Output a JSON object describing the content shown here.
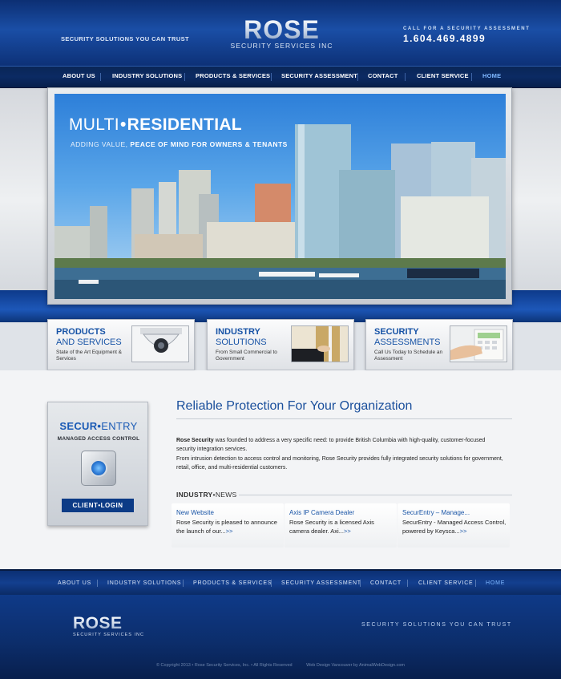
{
  "header": {
    "tagline": "SECURITY SOLUTIONS YOU CAN TRUST",
    "logo_main": "ROSE",
    "logo_sub": "SECURITY SERVICES INC",
    "call_label": "CALL FOR A SECURITY ASSESSMENT",
    "phone": "1.604.469.4899"
  },
  "nav": {
    "items": [
      "ABOUT US",
      "INDUSTRY SOLUTIONS",
      "PRODUCTS & SERVICES",
      "SECURITY ASSESSMENT",
      "CONTACT",
      "CLIENT SERVICE",
      "HOME"
    ],
    "active": "HOME"
  },
  "hero": {
    "title_light": "MULTI",
    "title_dot": "•",
    "title_bold": "RESIDENTIAL",
    "subtitle_light": "ADDING VALUE,",
    "subtitle_bold": "PEACE OF MIND FOR OWNERS & TENANTS"
  },
  "features": [
    {
      "line1": "PRODUCTS",
      "line2": "AND SERVICES",
      "desc": "State of the Art Equipment & Services",
      "image": "security-camera"
    },
    {
      "line1": "INDUSTRY",
      "line2": "SOLUTIONS",
      "desc": "From Small Commercial to Government",
      "image": "handshake-door"
    },
    {
      "line1": "SECURITY",
      "line2": "ASSESSMENTS",
      "desc": "Call Us Today to Schedule an Assessment",
      "image": "keypad"
    }
  ],
  "entry": {
    "title_bold": "SECUR",
    "title_dot": "•",
    "title_light": "ENTRY",
    "subtitle": "MANAGED ACCESS CONTROL",
    "login_a": "CLIENT",
    "login_dot": "•",
    "login_b": "LOGIN"
  },
  "main": {
    "title": "Reliable Protection For Your Organization",
    "para1_bold": "Rose Security",
    "para1_rest": " was founded to address a very specific need:  to provide British Columbia with high-quality, customer-focused security integration services.",
    "para2": "From intrusion detection to access control and monitoring, Rose Security provides fully integrated security solutions for government, retail, office, and multi-residential customers."
  },
  "news": {
    "heading_a": "INDUSTRY",
    "heading_dot": "•",
    "heading_b": "NEWS",
    "items": [
      {
        "title": "New Website",
        "body": "Rose Security is pleased to announce the launch of our...",
        "more": ">>"
      },
      {
        "title": "Axis IP Camera Dealer",
        "body": "Rose Security is a licensed Axis camera dealer. Axi...",
        "more": ">>"
      },
      {
        "title": "SecurEntry – Manage...",
        "body": "SecurEntry - Managed Access Control, powered by Keysca...",
        "more": ">>"
      }
    ]
  },
  "footer": {
    "nav": [
      "ABOUT US",
      "INDUSTRY SOLUTIONS",
      "PRODUCTS & SERVICES",
      "SECURITY ASSESSMENT",
      "CONTACT",
      "CLIENT SERVICE",
      "HOME"
    ],
    "logo_main": "ROSE",
    "logo_sub": "SECURITY SERVICES INC",
    "tagline": "SECURITY SOLUTIONS YOU CAN TRUST",
    "copyright": "© Copyright 2013 •  Rose Security Services, Inc.  •  All Rights Reserved",
    "credit": "Web Design Vancouver by AnimalWebDesign.com"
  },
  "colors": {
    "brand_blue": "#1a4ea6",
    "nav_dark": "#0b2a63",
    "link_blue": "#1a55a6",
    "active_nav": "#7fb8ff"
  }
}
